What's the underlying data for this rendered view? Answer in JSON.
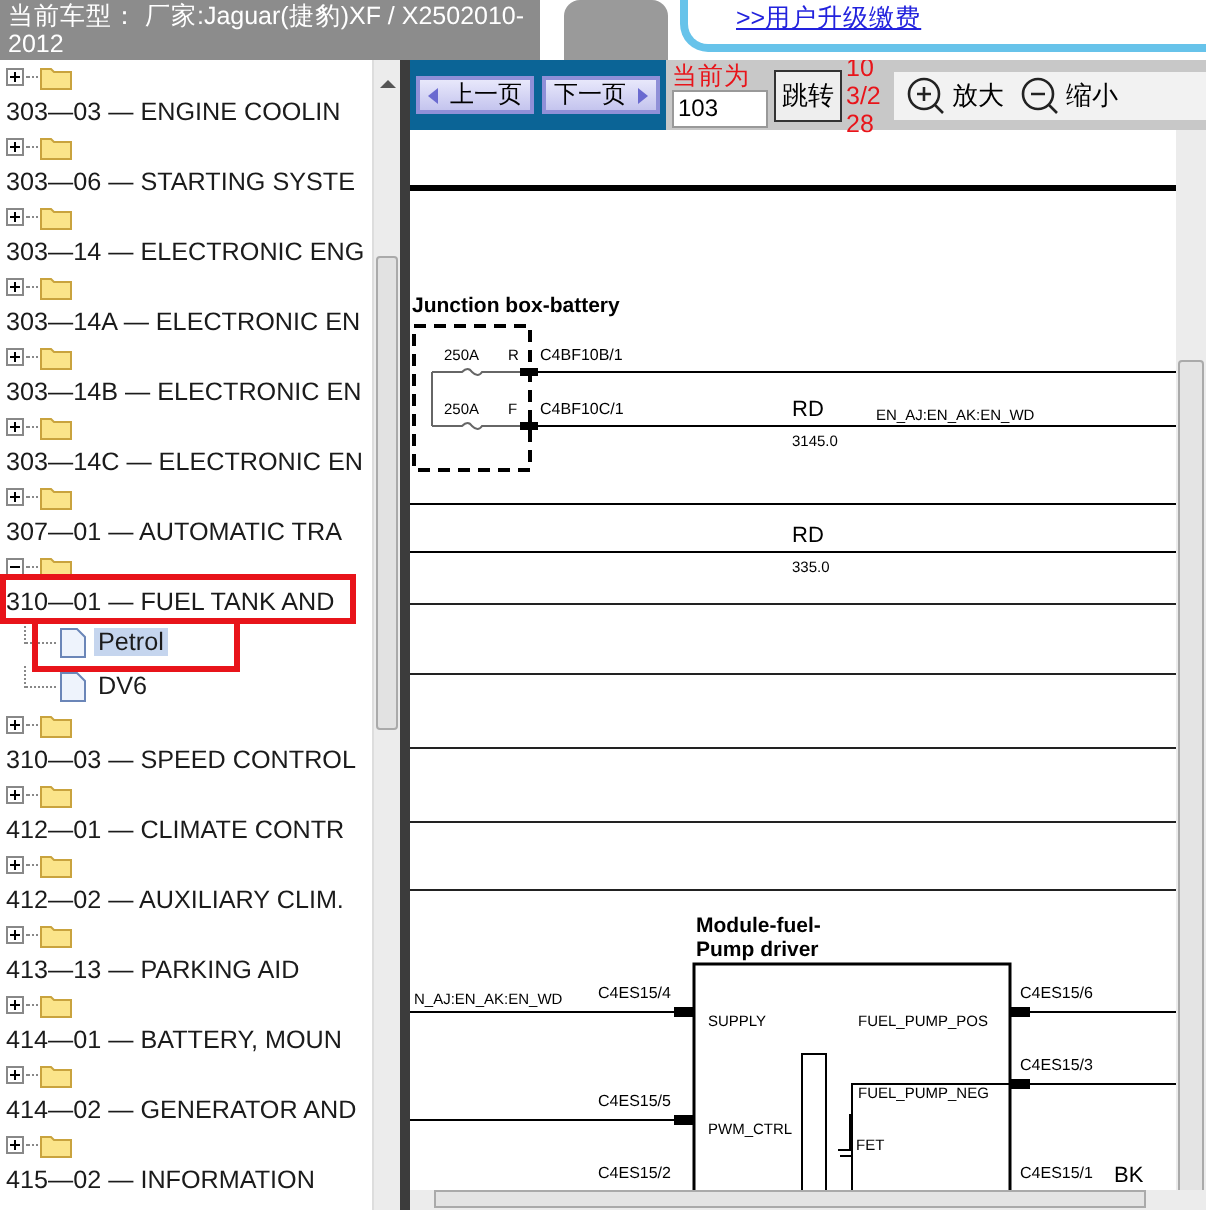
{
  "header": {
    "title": "当前车型： 厂家:Jaguar(捷豹)XF / X2502010-2012",
    "upgrade_link": ">>用户升级缴费"
  },
  "toolbar": {
    "prev_button": "上一页",
    "next_button": "下一页",
    "current_label": "当前为",
    "page_input": "103",
    "jump_button": "跳转",
    "page_count": "103/228",
    "zoom_in": "放大",
    "zoom_out": "缩小"
  },
  "tree": [
    {
      "label": "303—03 — ENGINE COOLIN",
      "expanded": false
    },
    {
      "label": "303—06 — STARTING SYSTE",
      "expanded": false
    },
    {
      "label": "303—14 — ELECTRONIC ENG",
      "expanded": false
    },
    {
      "label": "303—14A — ELECTRONIC EN",
      "expanded": false
    },
    {
      "label": "303—14B — ELECTRONIC EN",
      "expanded": false
    },
    {
      "label": "303—14C — ELECTRONIC EN",
      "expanded": false
    },
    {
      "label": "307—01 — AUTOMATIC TRA",
      "expanded": false
    },
    {
      "label": "310—01 — FUEL TANK AND",
      "expanded": true,
      "children": [
        {
          "label": "Petrol",
          "selected": true
        },
        {
          "label": "DV6",
          "selected": false
        }
      ]
    },
    {
      "label": "310—03 — SPEED CONTROL",
      "expanded": false
    },
    {
      "label": "412—01 — CLIMATE CONTR",
      "expanded": false
    },
    {
      "label": "412—02 — AUXILIARY CLIM.",
      "expanded": false
    },
    {
      "label": "413—13 — PARKING AID",
      "expanded": false
    },
    {
      "label": "414—01 — BATTERY, MOUN",
      "expanded": false
    },
    {
      "label": "414—02 — GENERATOR AND",
      "expanded": false
    },
    {
      "label": "415—02 — INFORMATION",
      "expanded": false
    }
  ],
  "diagram": {
    "junction_box": "Junction box-battery",
    "fuses": [
      {
        "rating": "250A",
        "pin": "R",
        "connector": "C4BF10B/1"
      },
      {
        "rating": "250A",
        "pin": "F",
        "connector": "C4BF10C/1"
      }
    ],
    "wires": [
      {
        "code": "RD",
        "length": "3145.0",
        "circuit": "EN_AJ:EN_AK:EN_WD"
      },
      {
        "code": "RD",
        "length": "335.0"
      }
    ],
    "module": {
      "title_lines": [
        "Module-fuel-",
        "Pump driver"
      ],
      "incoming_circuit": "N_AJ:EN_AK:EN_WD",
      "fet": "FET",
      "pins": [
        {
          "connector": "C4ES15/4",
          "signal": "SUPPLY",
          "kind": "left"
        },
        {
          "connector": "C4ES15/6",
          "signal": "FUEL_PUMP_POS",
          "kind": "right"
        },
        {
          "connector": "C4ES15/3",
          "signal": "FUEL_PUMP_NEG",
          "kind": "right"
        },
        {
          "connector": "C4ES15/5",
          "signal": "PWM_CTRL",
          "kind": "left"
        },
        {
          "connector": "C4ES15/2",
          "kind": "left"
        },
        {
          "connector": "C4ES15/1",
          "kind": "right",
          "wire_code": "BK"
        }
      ]
    }
  }
}
